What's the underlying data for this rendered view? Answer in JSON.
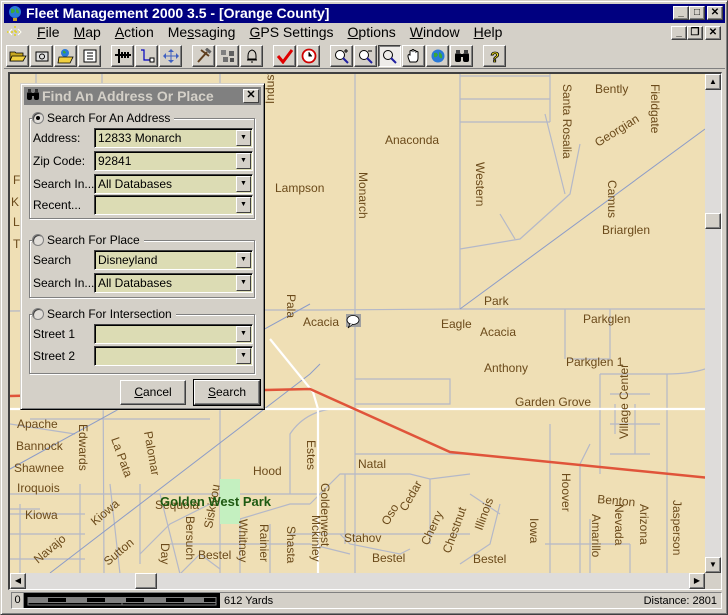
{
  "window": {
    "title": "Fleet Management 2000 3.5 - [Orange County]",
    "controls": {
      "minimize": "_",
      "maximize": "□",
      "close": "✕",
      "restore": "❐"
    }
  },
  "menubar": {
    "items": [
      {
        "label": "File",
        "accel": "F",
        "rest": "ile"
      },
      {
        "label": "Map",
        "accel": "M",
        "rest": "ap"
      },
      {
        "label": "Action",
        "accel": "A",
        "rest": "ction"
      },
      {
        "label": "Messaging",
        "pre": "Me",
        "accel": "s",
        "rest": "saging"
      },
      {
        "label": "GPS Settings",
        "accel": "G",
        "rest": "PS Settings"
      },
      {
        "label": "Options",
        "accel": "O",
        "rest": "ptions"
      },
      {
        "label": "Window",
        "accel": "W",
        "rest": "indow"
      },
      {
        "label": "Help",
        "accel": "H",
        "rest": "elp"
      }
    ]
  },
  "toolbar": {
    "buttons": [
      {
        "name": "open-folder",
        "glyph": "📂"
      },
      {
        "name": "camera",
        "glyph": "📷"
      },
      {
        "name": "open-map",
        "glyph": "🗂"
      },
      {
        "name": "list",
        "glyph": "☰"
      },
      {
        "name": "route-tool",
        "glyph": "┿"
      },
      {
        "name": "path",
        "glyph": "↳"
      },
      {
        "name": "move",
        "glyph": "✥"
      },
      {
        "name": "tools",
        "glyph": "⚒"
      },
      {
        "name": "vehicles",
        "glyph": "⚙"
      },
      {
        "name": "alarm-bell",
        "glyph": "🔔"
      },
      {
        "name": "check",
        "glyph": "✔"
      },
      {
        "name": "clock",
        "glyph": "⏱"
      },
      {
        "name": "zoom-in",
        "glyph": "🔍+"
      },
      {
        "name": "zoom-out",
        "glyph": "🔍−"
      },
      {
        "name": "zoom-select",
        "glyph": "🔍",
        "pressed": true
      },
      {
        "name": "pan-hand",
        "glyph": "✋"
      },
      {
        "name": "globe",
        "glyph": "🌐"
      },
      {
        "name": "binoculars",
        "glyph": "🔭"
      },
      {
        "name": "help",
        "glyph": "?"
      }
    ]
  },
  "dialog": {
    "title": "Find An Address Or Place",
    "address_group": {
      "label": "Search For An Address",
      "selected": true,
      "fields": [
        {
          "label": "Address:",
          "value": "12833 Monarch"
        },
        {
          "label": "Zip Code:",
          "value": "92841"
        },
        {
          "label": "Search In...",
          "value": "All Databases"
        },
        {
          "label": "Recent...",
          "value": ""
        }
      ]
    },
    "place_group": {
      "label": "Search For Place",
      "selected": false,
      "fields": [
        {
          "label": "Search",
          "value": "Disneyland"
        },
        {
          "label": "Search In...",
          "value": "All Databases"
        }
      ]
    },
    "intersection_group": {
      "label": "Search For Intersection",
      "selected": false,
      "fields": [
        {
          "label": "Street 1",
          "value": ""
        },
        {
          "label": "Street 2",
          "value": ""
        }
      ]
    },
    "buttons": {
      "cancel": {
        "accel": "C",
        "rest": "ancel"
      },
      "search": {
        "accel": "S",
        "rest": "earch"
      }
    }
  },
  "map": {
    "background": "#efdfb5",
    "street_labels": [
      {
        "text": "Bently"
      },
      {
        "text": "Fieldgate"
      },
      {
        "text": "Santa Rosalia"
      },
      {
        "text": "Georgian"
      },
      {
        "text": "Industry"
      },
      {
        "text": "Anaconda"
      },
      {
        "text": "Lampson"
      },
      {
        "text": "Monarch"
      },
      {
        "text": "Western"
      },
      {
        "text": "Camus"
      },
      {
        "text": "Briarglen"
      },
      {
        "text": "Pala"
      },
      {
        "text": "Acacia"
      },
      {
        "text": "Park"
      },
      {
        "text": "Eagle"
      },
      {
        "text": "Acacia"
      },
      {
        "text": "Parkglen"
      },
      {
        "text": "Parkglen 1"
      },
      {
        "text": "Village Center"
      },
      {
        "text": "Anthony"
      },
      {
        "text": "Garden Grove"
      },
      {
        "text": "Apache"
      },
      {
        "text": "Bannock"
      },
      {
        "text": "Shawnee"
      },
      {
        "text": "Iroquois"
      },
      {
        "text": "Kiowa"
      },
      {
        "text": "Navajo"
      },
      {
        "text": "Edwards"
      },
      {
        "text": "La Pata"
      },
      {
        "text": "Palomar"
      },
      {
        "text": "Kiowa"
      },
      {
        "text": "Sutton"
      },
      {
        "text": "Sequoia"
      },
      {
        "text": "Hood"
      },
      {
        "text": "Estes"
      },
      {
        "text": "Natal"
      },
      {
        "text": "Goldenwest"
      },
      {
        "text": "Mckinley"
      },
      {
        "text": "Bersuch"
      },
      {
        "text": "Siskiyou"
      },
      {
        "text": "Whitney"
      },
      {
        "text": "Rainier"
      },
      {
        "text": "Shasta"
      },
      {
        "text": "Day"
      },
      {
        "text": "Bestel"
      },
      {
        "text": "Stahov"
      },
      {
        "text": "Bestel"
      },
      {
        "text": "Oso"
      },
      {
        "text": "Cedar"
      },
      {
        "text": "Cherry"
      },
      {
        "text": "Chestnut"
      },
      {
        "text": "Illinois"
      },
      {
        "text": "Bestel"
      },
      {
        "text": "Iowa"
      },
      {
        "text": "Hoover"
      },
      {
        "text": "Benton"
      },
      {
        "text": "Amarillo"
      },
      {
        "text": "Nevada"
      },
      {
        "text": "Arizona"
      },
      {
        "text": "Jasperson"
      }
    ],
    "park_label": "Golden West Park",
    "edge_letters": [
      "F",
      "K",
      "L",
      "T"
    ]
  },
  "statusbar": {
    "scale_zero": "0",
    "scale_label": "612 Yards",
    "distance": "Distance: 2801"
  }
}
